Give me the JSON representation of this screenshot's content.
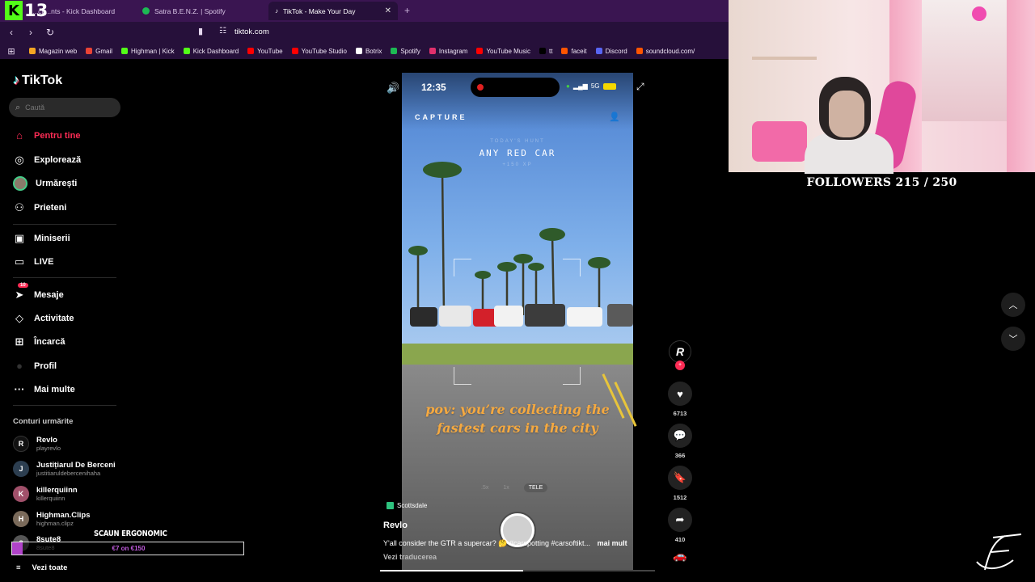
{
  "browser": {
    "kick_overlay": {
      "letter": "K",
      "number": "13"
    },
    "tabs": [
      {
        "label": "...ch...nts - Kick Dashboard",
        "color": "#53fc18",
        "active": false
      },
      {
        "label": "Satra B.E.N.Z. | Spotify",
        "color": "#1db954",
        "active": false
      },
      {
        "label": "TikTok - Make Your Day",
        "color": "#ffffff",
        "active": true
      }
    ],
    "close_glyph": "✕",
    "new_tab_glyph": "+",
    "url": "tiktok.com",
    "bookmarks": [
      {
        "label": "Magazin web",
        "color": "#f5a623"
      },
      {
        "label": "Gmail",
        "color": "#ea4335"
      },
      {
        "label": "Highman | Kick",
        "color": "#53fc18"
      },
      {
        "label": "Kick Dashboard",
        "color": "#53fc18"
      },
      {
        "label": "YouTube",
        "color": "#ff0000"
      },
      {
        "label": "YouTube Studio",
        "color": "#ff0000"
      },
      {
        "label": "Botrix",
        "color": "#ffffff"
      },
      {
        "label": "Spotify",
        "color": "#1db954"
      },
      {
        "label": "Instagram",
        "color": "#e1306c"
      },
      {
        "label": "YouTube Music",
        "color": "#ff0000"
      },
      {
        "label": "tt",
        "color": "#000000"
      },
      {
        "label": "faceit",
        "color": "#ff5500"
      },
      {
        "label": "Discord",
        "color": "#5865f2"
      },
      {
        "label": "soundcloud.com/",
        "color": "#ff5500"
      }
    ]
  },
  "sidebar": {
    "logo": "TikTok",
    "search_placeholder": "Caută",
    "menu": [
      {
        "label": "Pentru tine",
        "icon": "home-icon",
        "glyph": "⌂"
      },
      {
        "label": "Explorează",
        "icon": "compass-icon",
        "glyph": "◎"
      },
      {
        "label": "Urmărești",
        "icon": "avatar",
        "glyph": ""
      },
      {
        "label": "Prieteni",
        "icon": "friends-icon",
        "glyph": "⚇"
      },
      {
        "label": "Miniserii",
        "icon": "miniseries-icon",
        "glyph": "▣"
      },
      {
        "label": "LIVE",
        "icon": "live-icon",
        "glyph": "▭"
      },
      {
        "label": "Mesaje",
        "icon": "messages-icon",
        "glyph": "➤"
      },
      {
        "label": "Activitate",
        "icon": "activity-icon",
        "glyph": "◇"
      },
      {
        "label": "Încarcă",
        "icon": "upload-icon",
        "glyph": "⊞"
      },
      {
        "label": "Profil",
        "icon": "profile-icon",
        "glyph": "●"
      },
      {
        "label": "Mai multe",
        "icon": "more-icon",
        "glyph": "···"
      }
    ],
    "messages_badge": "10",
    "following_title": "Conturi urmărite",
    "following": [
      {
        "name": "Revlo",
        "handle": "playrevlo",
        "initial": "R"
      },
      {
        "name": "Justițiarul De Berceni",
        "handle": "justitiaruldebercenihaha",
        "initial": "J"
      },
      {
        "name": "killerquiinn",
        "handle": "killerquiinn",
        "initial": "K"
      },
      {
        "name": "Highman.Clips",
        "handle": "highman.clipz",
        "initial": "H"
      },
      {
        "name": "8sute8",
        "handle": "8sute8",
        "initial": "8"
      }
    ],
    "see_all": "Vezi toate",
    "see_all_glyph": "≡"
  },
  "overlay_goal": {
    "title": "SCAUN ERGONOMIC",
    "amount": "€7 on €150",
    "progress_fraction": 0.047
  },
  "video": {
    "status_time": "12:35",
    "signal": "5G",
    "capture_label": "CAPTURE",
    "today_hint": "TODAY'S HUNT",
    "target": "ANY RED CAR",
    "plus_hint": "+150 XP",
    "caption_line1": "pov: you’re collecting the",
    "caption_line2": "fastest cars in the city",
    "zoom_options": [
      ".5x",
      "1x",
      "TELE"
    ],
    "zoom_selected": "TELE",
    "location": "Scottsdale",
    "author": "Revlo",
    "description": "Y'all consider the GTR a supercar? 🤔 #carspotting #carsoftikt...",
    "more": "mai mult",
    "translate": "Vezi traducerea",
    "playback_fraction": 0.52,
    "volume_glyph": "🔊",
    "expand_glyph": "⤢",
    "profile_glyph": "👤"
  },
  "actions": {
    "creator_initial": "R",
    "plus_glyph": "+",
    "likes": "6713",
    "comments": "366",
    "saves": "1512",
    "shares": "410",
    "like_glyph": "♥",
    "comment_glyph": "💬",
    "save_glyph": "🔖",
    "share_glyph": "➦",
    "music_glyph": "🚗"
  },
  "nav": {
    "back_glyph": "‹",
    "forward_glyph": "›",
    "reload_glyph": "↻",
    "bookmark_glyph": "🔖",
    "site_glyph": "⚙",
    "apps_glyph": "⊞",
    "up_glyph": "︿",
    "down_glyph": "﹀"
  },
  "stream": {
    "followers_text": "FOLLOWERS 215 / 250"
  }
}
